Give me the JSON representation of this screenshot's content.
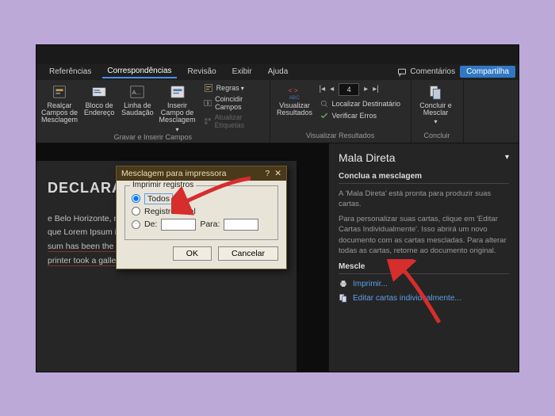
{
  "tabs": {
    "referencias": "Referências",
    "correspondencias": "Correspondências",
    "revisao": "Revisão",
    "exibir": "Exibir",
    "ajuda": "Ajuda",
    "comentarios": "Comentários",
    "compartilhar": "Compartilha"
  },
  "ribbon": {
    "realcar": "Realçar Campos de Mesclagem",
    "bloco": "Bloco de Endereço",
    "linha": "Linha de Saudação",
    "inserir": "Inserir Campo de Mesclagem",
    "regras": "Regras",
    "coincidir": "Coincidir Campos",
    "atualizar": "Atualizar Etiquetas",
    "visualizar": "Visualizar Resultados",
    "record_box": "4",
    "localizar": "Localizar Destinatário",
    "verificar": "Verificar Erros",
    "concluir": "Concluir e Mesclar",
    "grp_gravar": "Gravar e Inserir Campos",
    "grp_visualizar": "Visualizar Resultados",
    "grp_concluir": "Concluir"
  },
  "doc": {
    "title": "DECLARAÇÃ",
    "body_l1_pre": "e Belo Horizonte, resid",
    "body_l2_pre": "que Lorem Ipsum is sim",
    "body_l3": "sum has been the industry's standard dummy text ever since",
    "body_l4": "printer took a galley of type and scrambled it to make a type"
  },
  "pane": {
    "title": "Mala Direta",
    "sec1": "Conclua a mesclagem",
    "txt1": "A 'Mala Direta' está pronta para produzir suas cartas.",
    "txt2": "Para personalizar suas cartas, clique em 'Editar Cartas Individualmente'. Isso abrirá um novo documento com as cartas mescladas. Para alterar todas as cartas, retorne ao documento original.",
    "sec2": "Mescle",
    "link_print": "Imprimir...",
    "link_edit": "Editar cartas individualmente..."
  },
  "dialog": {
    "title": "Mesclagem para impressora",
    "help": "?",
    "close": "✕",
    "legend": "Imprimir registros",
    "opt_all": "Todos",
    "opt_current": "Registro atual",
    "opt_range": "De:",
    "range_to": "Para:",
    "ok": "OK",
    "cancel": "Cancelar"
  }
}
